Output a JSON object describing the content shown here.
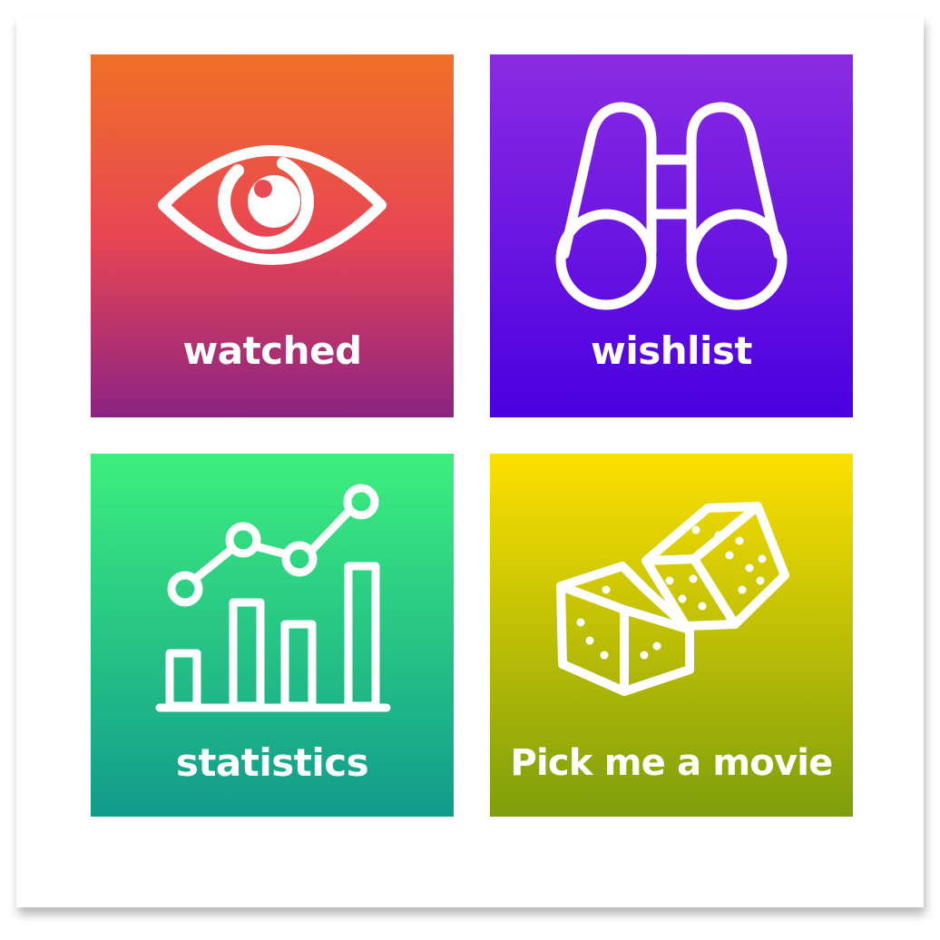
{
  "tiles": [
    {
      "id": "watched",
      "label": "watched",
      "icon": "eye-icon",
      "gradient": [
        "#f07027",
        "#e84653",
        "#8c2283"
      ]
    },
    {
      "id": "wishlist",
      "label": "wishlist",
      "icon": "binoculars-icon",
      "gradient": [
        "#8b2be2",
        "#4b00e0"
      ]
    },
    {
      "id": "statistics",
      "label": "statistics",
      "icon": "bar-line-chart-icon",
      "gradient": [
        "#3def7e",
        "#119b8c"
      ]
    },
    {
      "id": "random",
      "label": "Pick me a movie",
      "icon": "dice-icon",
      "gradient": [
        "#fde000",
        "#7e9e0c"
      ]
    }
  ]
}
